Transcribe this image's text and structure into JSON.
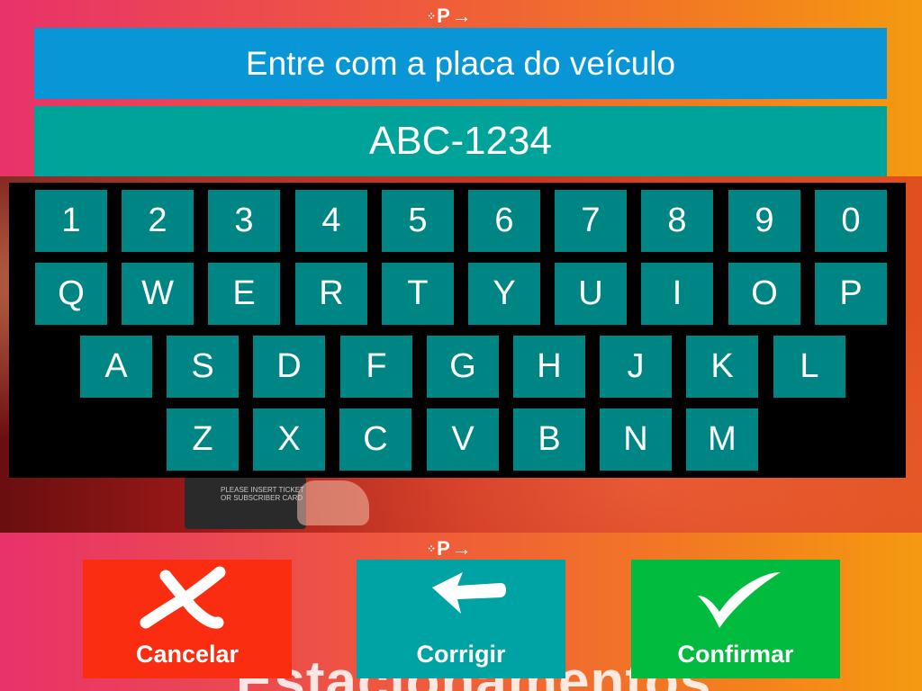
{
  "header": {
    "title": "Entre com a placa do veículo"
  },
  "plate": {
    "value": "ABC-1234"
  },
  "keyboard": {
    "row1": [
      "1",
      "2",
      "3",
      "4",
      "5",
      "6",
      "7",
      "8",
      "9",
      "0"
    ],
    "row2": [
      "Q",
      "W",
      "E",
      "R",
      "T",
      "Y",
      "U",
      "I",
      "O",
      "P"
    ],
    "row3": [
      "A",
      "S",
      "D",
      "F",
      "G",
      "H",
      "J",
      "K",
      "L"
    ],
    "row4": [
      "Z",
      "X",
      "C",
      "V",
      "B",
      "N",
      "M"
    ]
  },
  "actions": {
    "cancel_label": "Cancelar",
    "fix_label": "Corrigir",
    "confirm_label": "Confirmar"
  },
  "background": {
    "brand_letter": "P",
    "brand_arrow": "→",
    "brand_dots": "⁘",
    "ticket_text": "PLEASE INSERT TICKET OR SUBSCRIBER CARD",
    "bottom_word": "Estacionamentos"
  },
  "icons": {
    "cancel": "close-icon",
    "fix": "arrow-left-icon",
    "confirm": "check-icon"
  },
  "colors": {
    "title_bar": "#0996d6",
    "plate_display": "#00a39a",
    "key": "#008585",
    "cancel": "#fa2d10",
    "fix": "#00a3a3",
    "confirm": "#00bb3d"
  }
}
